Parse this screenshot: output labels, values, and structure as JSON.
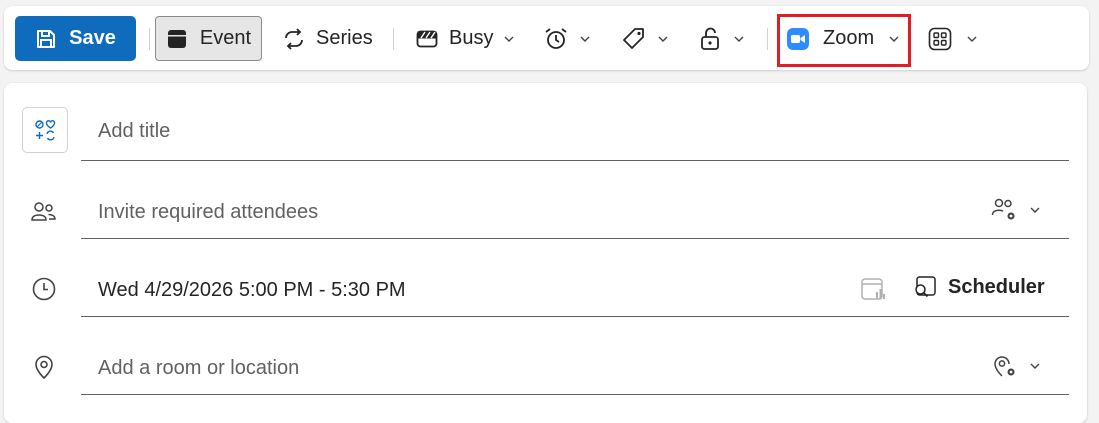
{
  "toolbar": {
    "save_label": "Save",
    "event_label": "Event",
    "series_label": "Series",
    "busy_label": "Busy",
    "zoom_label": "Zoom"
  },
  "form": {
    "title_placeholder": "Add title",
    "attendees_placeholder": "Invite required attendees",
    "datetime_value": "Wed 4/29/2026 5:00 PM - 5:30 PM",
    "scheduler_label": "Scheduler",
    "location_placeholder": "Add a room or location"
  },
  "colors": {
    "save_button": "#0f6cbd",
    "zoom_brand": "#2d8cff",
    "highlight_box": "#e01c24"
  },
  "icons": {
    "save": "save-icon",
    "event": "calendar-icon",
    "series": "repeat-icon",
    "busy": "busy-status-icon",
    "reminder": "alarm-icon",
    "category": "tag-icon",
    "privacy": "unlock-icon",
    "zoom": "zoom-video-icon",
    "apps": "apps-grid-icon"
  }
}
